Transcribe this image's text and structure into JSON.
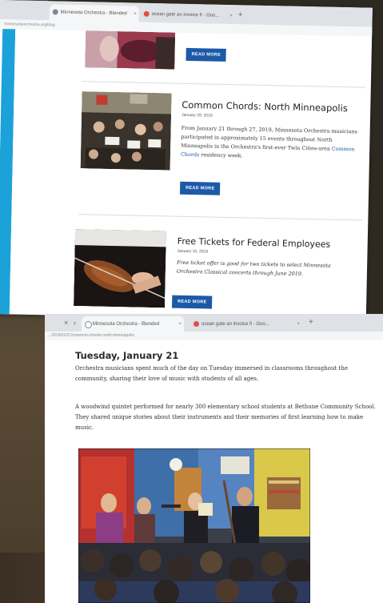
{
  "screen_top": {
    "tabs": [
      {
        "label": "Minnesota Orchestra - Blended",
        "active": true
      },
      {
        "label": "ocean gate an invoice fi - Goo...",
        "active": false
      }
    ],
    "new_tab": "+",
    "close": "×",
    "address": "minnesotaorchestra.org/blog",
    "posts": [
      {
        "button": "READ MORE"
      },
      {
        "title": "Common Chords: North Minneapolis",
        "date": "January 29, 2019",
        "body_before_link": "From January 21 through 27, 2019, Minnesota Orchestra musicians participated in approximately 15 events throughout North Minneapolis in the Orchestra's first-ever Twin Cities-area ",
        "body_link": "Common Chords",
        "body_after_link": " residency week.",
        "button": "READ MORE"
      },
      {
        "title": "Free Tickets for Federal Employees",
        "date": "January 15, 2019",
        "body": "Free ticket offer is good for two tickets to select Minnesota Orchestra Classical concerts through June 2019.",
        "button": "READ MORE"
      }
    ]
  },
  "screen_bottom": {
    "tabs": [
      {
        "label": "Minnesota Orchestra - Blended",
        "active": true
      },
      {
        "label": "ocean gate an invoice fi - Goo...",
        "active": false
      }
    ],
    "new_tab": "+",
    "close": "×",
    "back": "C",
    "address": "...2019/01/27/common-chords-north-minneapolis",
    "heading": "Tuesday, January 21",
    "paragraphs": [
      "Orchestra musicians spent much of the day on Tuesday immersed in classrooms throughout the community, sharing their love of music with students of all ages.",
      "A woodwind quintet performed for nearly 300 elementary school students at Bethune Community School. They shared unique stories about their instruments and their memories of first learning how to make music."
    ]
  },
  "colors": {
    "accent_blue": "#1c5aa8",
    "sidebar_cyan": "#1ba2d8",
    "tab_bar": "#dee1e6"
  }
}
